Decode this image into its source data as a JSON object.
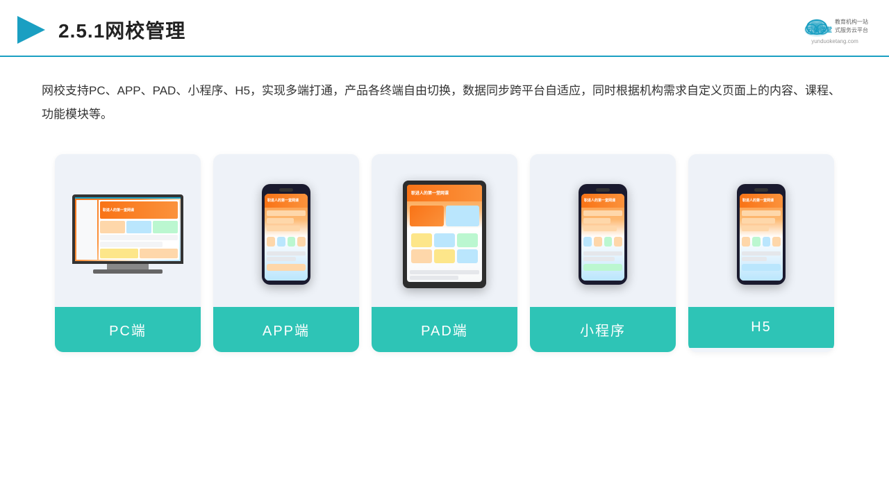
{
  "header": {
    "title": "2.5.1网校管理",
    "logo_brand": "云朵课堂",
    "logo_domain": "yunduoketang.com",
    "logo_tagline": "教育机构一站\n式服务云平台"
  },
  "description": {
    "text": "网校支持PC、APP、PAD、小程序、H5，实现多端打通，产品各终端自由切换，数据同步跨平台自适应，同时根据机构需求自定义页面上的内容、课程、功能模块等。"
  },
  "cards": [
    {
      "id": "pc",
      "label": "PC端",
      "type": "pc"
    },
    {
      "id": "app",
      "label": "APP端",
      "type": "phone"
    },
    {
      "id": "pad",
      "label": "PAD端",
      "type": "tablet"
    },
    {
      "id": "miniapp",
      "label": "小程序",
      "type": "phone"
    },
    {
      "id": "h5",
      "label": "H5",
      "type": "phone"
    }
  ]
}
